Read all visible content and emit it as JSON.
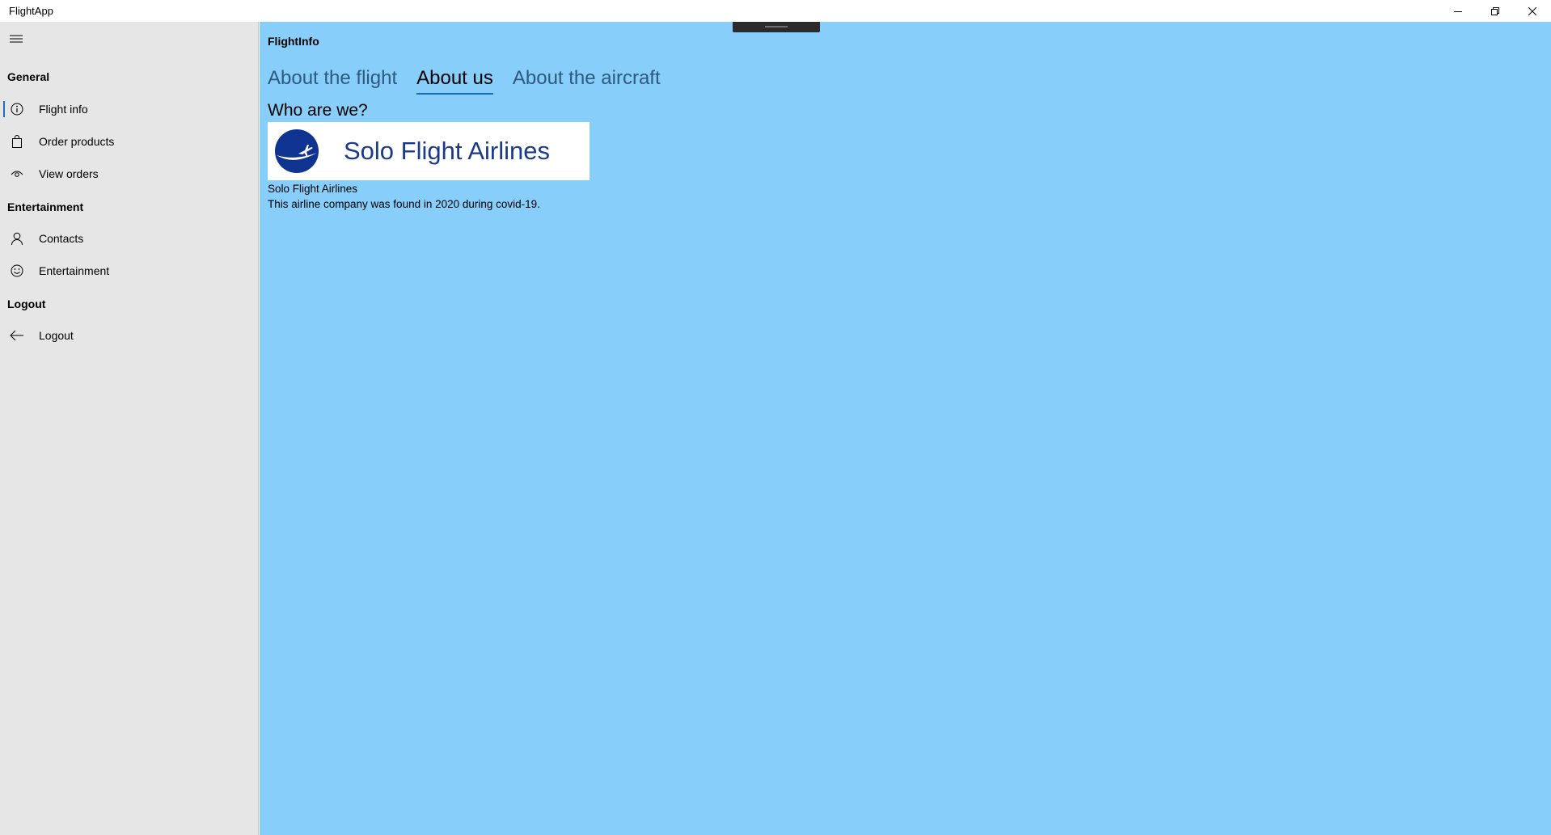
{
  "window": {
    "title": "FlightApp",
    "caption_icons": [
      "minimize-icon",
      "restore-icon",
      "close-icon"
    ]
  },
  "sidebar": {
    "groups": [
      {
        "header": "General",
        "items": [
          {
            "label": "Flight info",
            "icon": "info-icon",
            "selected": true
          },
          {
            "label": "Order products",
            "icon": "shopping-bag-icon"
          },
          {
            "label": "View orders",
            "icon": "eye-icon"
          }
        ]
      },
      {
        "header": "Entertainment",
        "items": [
          {
            "label": "Contacts",
            "icon": "person-icon"
          },
          {
            "label": "Entertainment",
            "icon": "smiley-icon"
          }
        ]
      },
      {
        "header": "Logout",
        "items": [
          {
            "label": "Logout",
            "icon": "back-arrow-icon"
          }
        ]
      }
    ]
  },
  "main": {
    "page_title": "FlightInfo",
    "tabs": [
      {
        "label": "About the flight",
        "active": false
      },
      {
        "label": "About us",
        "active": true
      },
      {
        "label": "About the aircraft",
        "active": false
      }
    ],
    "section_heading": "Who are we?",
    "logo_text": "Solo Flight Airlines",
    "company_name": "Solo Flight Airlines",
    "company_description": "This airline company was found in 2020 during covid-19."
  },
  "colors": {
    "content_background": "#87cefa",
    "sidebar_background": "#e6e6e6",
    "accent": "#1a6fc4",
    "logo_blue": "#1b3a8c"
  }
}
